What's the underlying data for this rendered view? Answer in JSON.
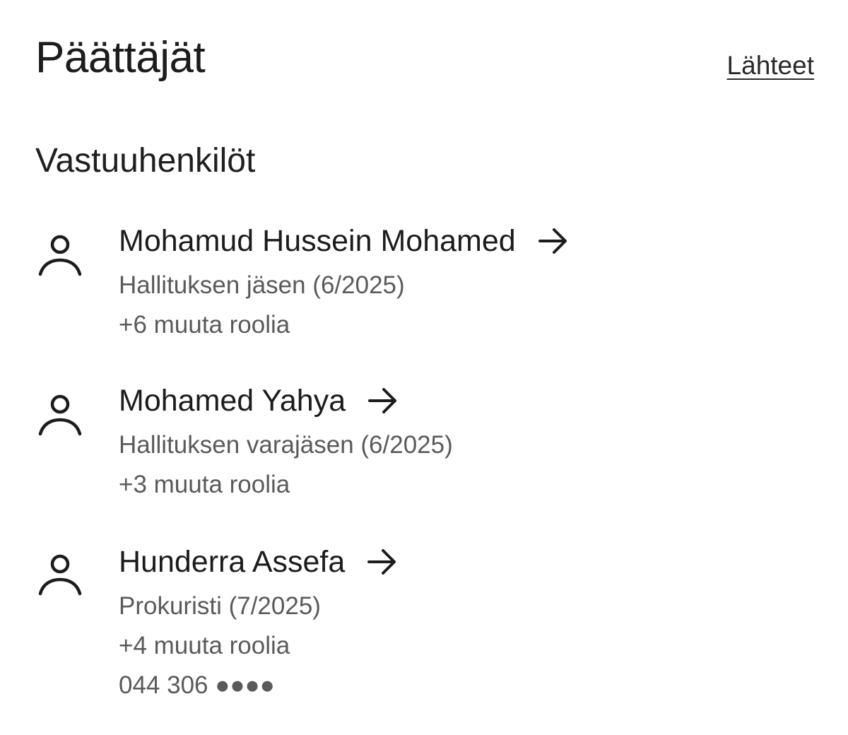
{
  "header": {
    "title": "Päättäjät",
    "sources_link": "Lähteet"
  },
  "section": {
    "title": "Vastuuhenkilöt"
  },
  "people": [
    {
      "name": "Mohamud Hussein Mohamed",
      "role": "Hallituksen jäsen (6/2025)",
      "more_roles": "+6 muuta roolia",
      "icon": "person-icon",
      "link_icon": "arrow-right-icon"
    },
    {
      "name": "Mohamed Yahya",
      "role": "Hallituksen varajäsen (6/2025)",
      "more_roles": "+3 muuta roolia",
      "icon": "person-icon",
      "link_icon": "arrow-right-icon"
    },
    {
      "name": "Hunderra Assefa",
      "role": "Prokuristi (7/2025)",
      "more_roles": "+4 muuta roolia",
      "phone": "044 306 ●●●●",
      "icon": "person-icon",
      "link_icon": "arrow-right-icon"
    }
  ]
}
